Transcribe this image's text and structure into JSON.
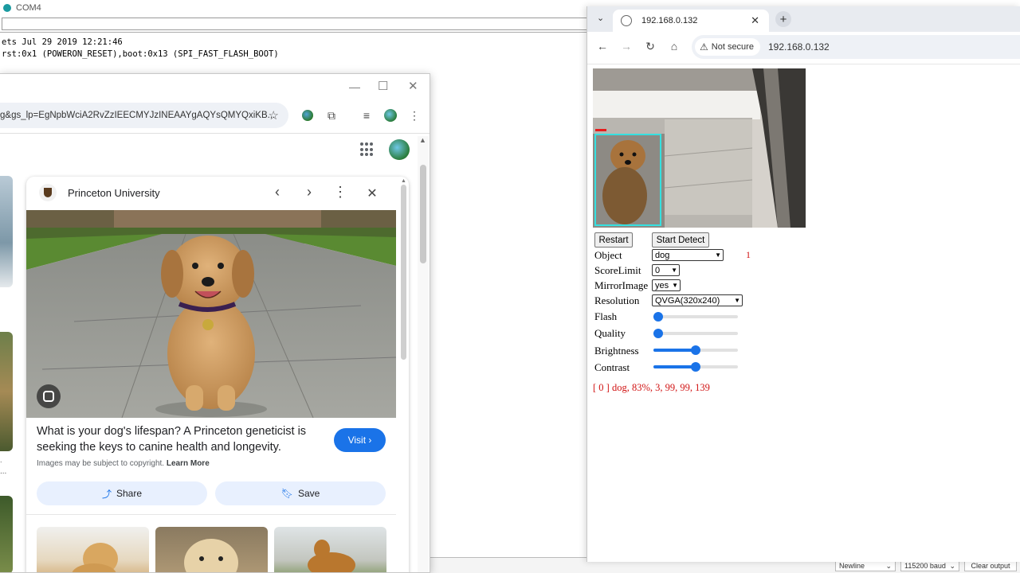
{
  "serial": {
    "title": "COM4",
    "lines": [
      "ets Jul 29 2019 12:21:46",
      "",
      "rst:0x1 (POWERON_RESET),boot:0x13 (SPI_FAST_FLASH_BOOT)"
    ],
    "line_ending": "Newline",
    "baud": "115200 baud",
    "clear_label": "Clear output"
  },
  "google_window": {
    "url": "g&gs_lp=EgNpbWciA2RvZzIEECMYJzINEAAYgAQYsQMYQxiKB...",
    "card": {
      "source": "Princeton University",
      "title": "What is your dog's lifespan? A Princeton geneticist is seeking the keys to canine health and longevity.",
      "visit_label": "Visit",
      "copyright_text": "Images may be subject to copyright.",
      "learn_more": "Learn More",
      "share_label": "Share",
      "save_label": "Save"
    },
    "side_text": [
      ".",
      "..."
    ]
  },
  "browser": {
    "tab_title": "192.168.0.132",
    "security_label": "Not secure",
    "url": "192.168.0.132",
    "buttons": {
      "restart": "Restart",
      "start_detect": "Start Detect"
    },
    "fields": {
      "object_label": "Object",
      "object_value": "dog",
      "object_count": "1",
      "score_label": "ScoreLimit",
      "score_value": "0",
      "mirror_label": "MirrorImage",
      "mirror_value": "yes",
      "resolution_label": "Resolution",
      "resolution_value": "QVGA(320x240)",
      "flash_label": "Flash",
      "flash_level": 0,
      "quality_label": "Quality",
      "quality_level": 0,
      "brightness_label": "Brightness",
      "brightness_level": 0.5,
      "contrast_label": "Contrast",
      "contrast_level": 0.5
    },
    "result": "[ 0 ] dog, 83%, 3, 99, 99, 139"
  },
  "colors": {
    "accent_blue": "#1a73e8",
    "detection_box": "#35e0e0",
    "result_red": "#d11313"
  }
}
